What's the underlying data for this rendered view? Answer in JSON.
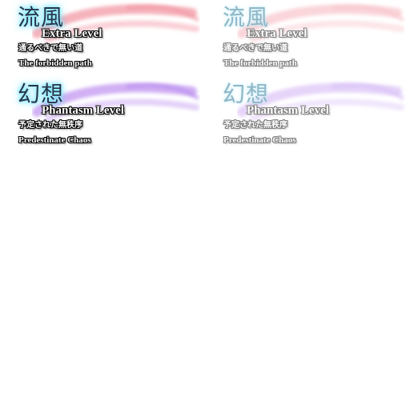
{
  "colors": {
    "extra_brush": "#f4a6b0",
    "phantasm_brush": "#c9a3f2",
    "kanji_glow": "#6fe6ff",
    "outline_active": "#000000",
    "outline_dim": "#7e7e7e"
  },
  "tiles": {
    "extra_active": {
      "state": "active",
      "kanji": "流風",
      "level": "Extra Level",
      "subtitle_jp": "通るべきで無い道",
      "subtitle_en": "The forbidden path"
    },
    "extra_dim": {
      "state": "dimmed",
      "kanji": "流風",
      "level": "Extra Level",
      "subtitle_jp": "通るべきで無い道",
      "subtitle_en": "The forbidden path"
    },
    "phantasm_active": {
      "state": "active",
      "kanji": "幻想",
      "level": "Phantasm Level",
      "subtitle_jp": "予定された無秩序",
      "subtitle_en": "Predestinate Chaos"
    },
    "phantasm_dim": {
      "state": "dimmed",
      "kanji": "幻想",
      "level": "Phantasm Level",
      "subtitle_jp": "予定された無秩序",
      "subtitle_en": "Predestinate Chaos"
    }
  }
}
